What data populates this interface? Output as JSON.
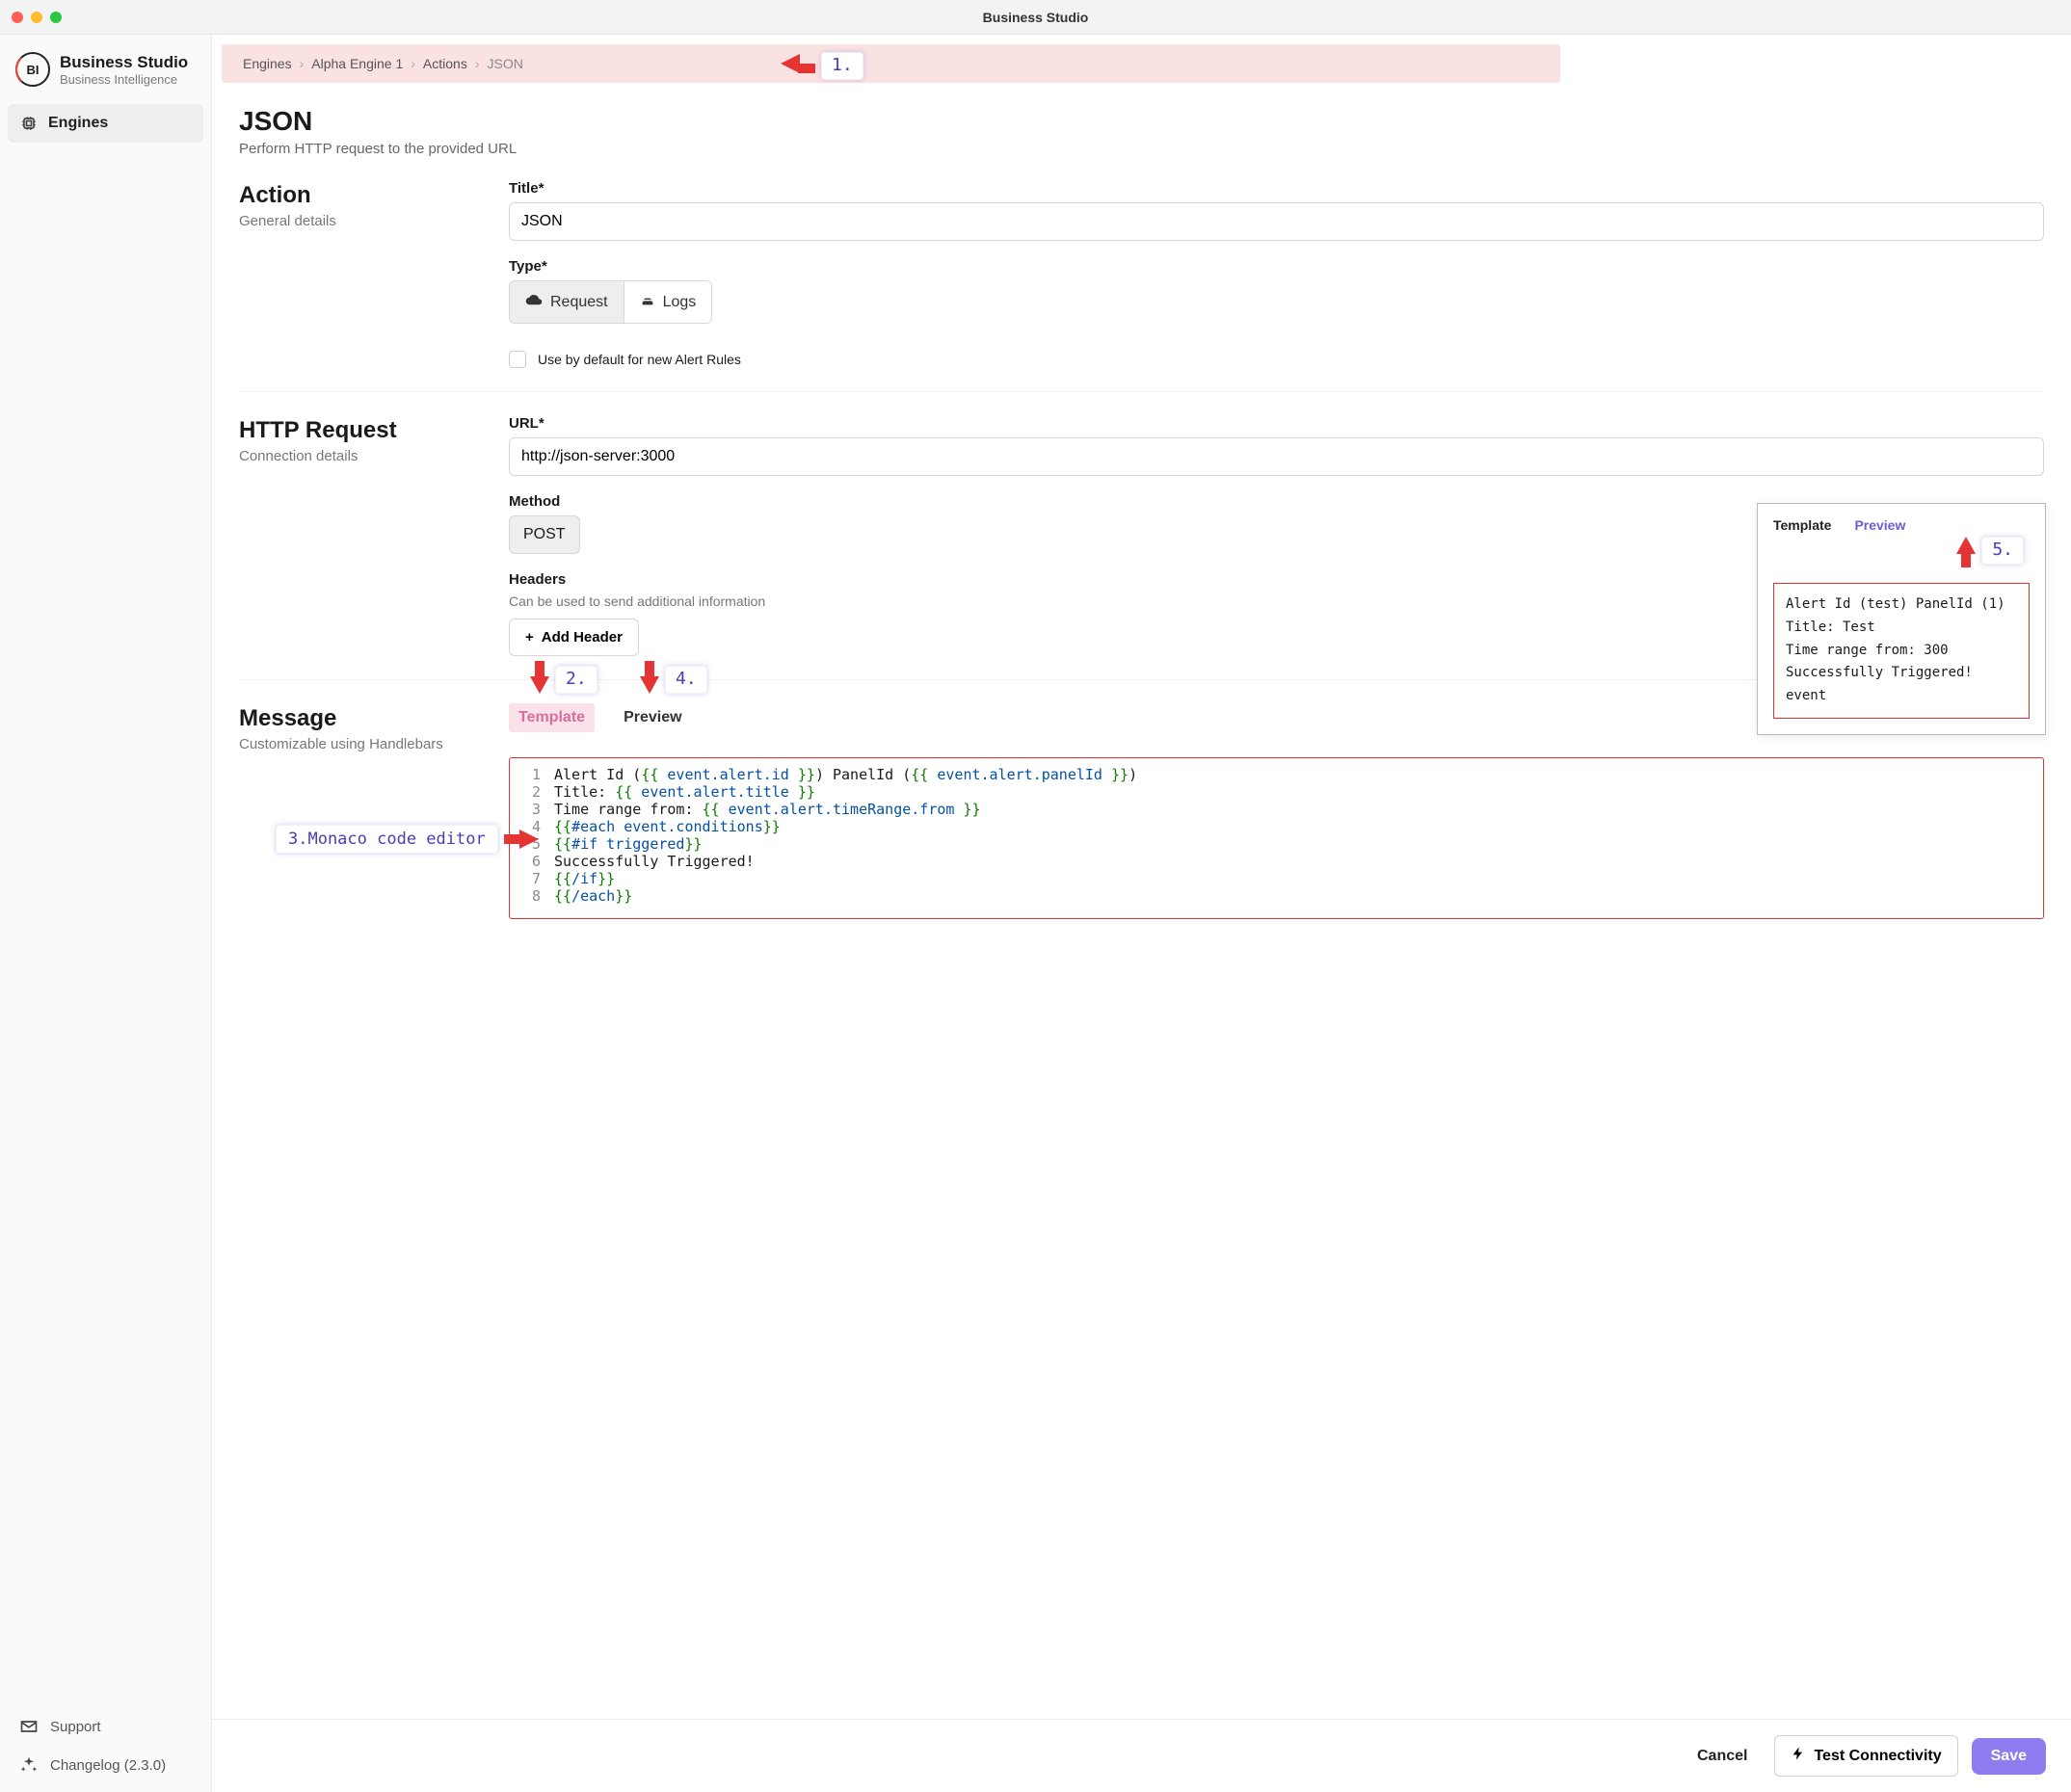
{
  "window": {
    "title": "Business Studio"
  },
  "brand": {
    "logo_text": "BI",
    "title": "Business Studio",
    "subtitle": "Business Intelligence"
  },
  "sidebar": {
    "items": [
      {
        "label": "Engines"
      }
    ],
    "bottom": {
      "support": "Support",
      "changelog": "Changelog (2.3.0)"
    }
  },
  "breadcrumb": {
    "items": [
      "Engines",
      "Alpha Engine 1",
      "Actions",
      "JSON"
    ]
  },
  "page": {
    "title": "JSON",
    "subtitle": "Perform HTTP request to the provided URL"
  },
  "action": {
    "heading": "Action",
    "sub": "General details",
    "title_label": "Title*",
    "title_value": "JSON",
    "type_label": "Type*",
    "type_options": {
      "request": "Request",
      "logs": "Logs"
    },
    "default_checkbox": "Use by default for new Alert Rules"
  },
  "http": {
    "heading": "HTTP Request",
    "sub": "Connection details",
    "url_label": "URL*",
    "url_value": "http://json-server:3000",
    "method_label": "Method",
    "method_value": "POST",
    "headers_label": "Headers",
    "headers_help": "Can be used to send additional information",
    "add_header": "Add Header"
  },
  "message": {
    "heading": "Message",
    "sub": "Customizable using Handlebars",
    "tabs": {
      "template": "Template",
      "preview": "Preview"
    },
    "code_lines": [
      "Alert Id ({{ event.alert.id }}) PanelId ({{ event.alert.panelId }})",
      "Title: {{ event.alert.title }}",
      "Time range from: {{ event.alert.timeRange.from }}",
      "{{#each event.conditions}}",
      "{{#if triggered}}",
      "Successfully Triggered!",
      "{{/if}}",
      "{{/each}}"
    ]
  },
  "preview_panel": {
    "tabs": {
      "template": "Template",
      "preview": "Preview"
    },
    "body": "Alert Id (test) PanelId (1)\nTitle: Test\nTime range from: 300\nSuccessfully Triggered!\nevent"
  },
  "footer": {
    "cancel": "Cancel",
    "test": "Test Connectivity",
    "save": "Save"
  },
  "annotations": {
    "a1": "1.",
    "a2": "2.",
    "a3": "3.Monaco code editor",
    "a4": "4.",
    "a5": "5."
  }
}
